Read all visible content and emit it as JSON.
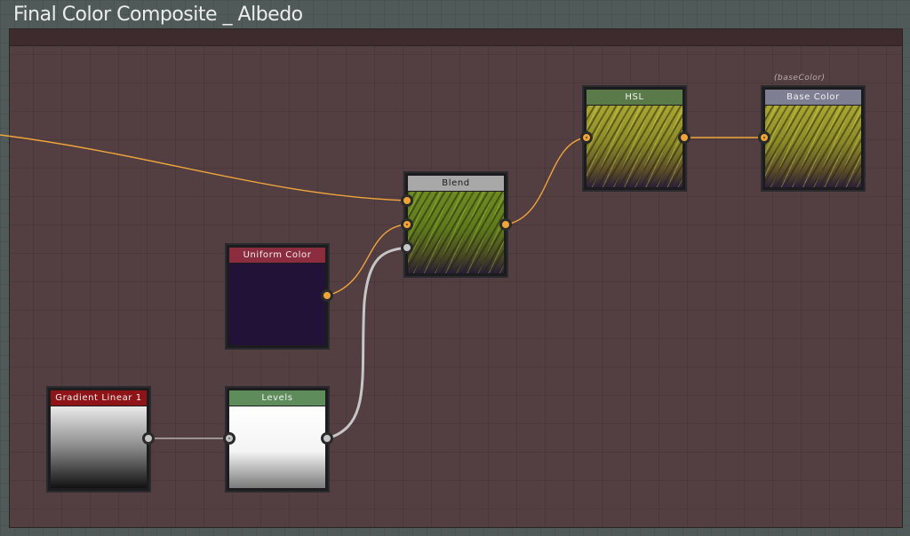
{
  "graph": {
    "frame_title": "Final Color Composite _ Albedo",
    "background_color": "#505a58",
    "frame_color": "#533e42",
    "wire_colors": {
      "color": "#f0a53a",
      "grayscale": "#c6c6c6"
    }
  },
  "nodes": {
    "blend": {
      "title": "Blend",
      "header_color": "#a8a8a8",
      "thumbnail": "grass-green"
    },
    "hsl": {
      "title": "HSL",
      "header_color": "#5a7a4a",
      "thumbnail": "grass-yellow"
    },
    "base_color": {
      "title": "Base Color",
      "identifier": "(baseColor)",
      "header_color": "#7f7f93",
      "thumbnail": "grass-yellow"
    },
    "uniform_color": {
      "title": "Uniform Color",
      "header_color": "#8b2d3e",
      "thumbnail": "uniform-purple"
    },
    "gradient_linear": {
      "title": "Gradient Linear 1",
      "header_color": "#8e1417",
      "thumbnail": "gradient-vertical"
    },
    "levels": {
      "title": "Levels",
      "header_color": "#5e8c5b",
      "thumbnail": "levels-white"
    }
  }
}
